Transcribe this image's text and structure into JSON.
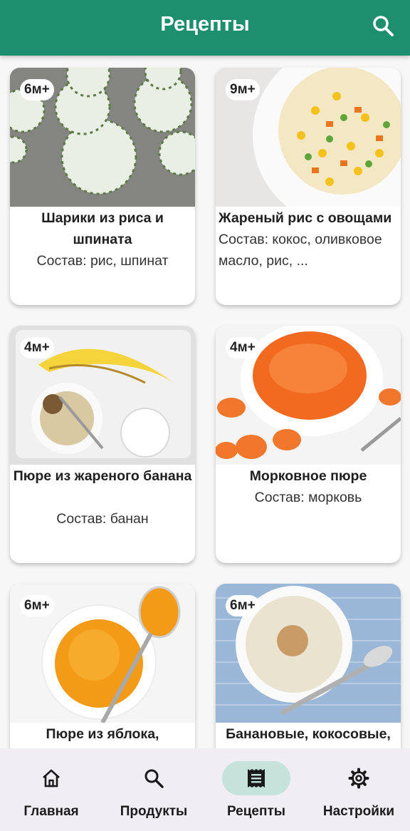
{
  "appbar": {
    "title": "Рецепты",
    "search_icon": "search-icon"
  },
  "recipes": [
    {
      "age": "6м+",
      "title": "Шарики из риса и шпината",
      "description": "Состав: рис, шпинат",
      "image": "rice-spinach-balls"
    },
    {
      "age": "9м+",
      "title": "Жареный рис с овощами",
      "description": "Состав: кокос, оливковое масло, рис, ...",
      "image": "fried-rice-vegetables"
    },
    {
      "age": "4м+",
      "title": "Пюре из жареного банана",
      "description": "Состав: банан",
      "image": "banana-puree"
    },
    {
      "age": "4м+",
      "title": "Морковное пюре",
      "description": "Состав: морковь",
      "image": "carrot-puree"
    },
    {
      "age": "6м+",
      "title": "Пюре из яблока,",
      "description": "",
      "image": "apple-puree"
    },
    {
      "age": "6м+",
      "title": "Банановые, кокосовые,",
      "description": "",
      "image": "banana-coconut-porridge"
    }
  ],
  "bottom_nav": {
    "items": [
      {
        "label": "Главная",
        "icon": "home-icon",
        "active": false
      },
      {
        "label": "Продукты",
        "icon": "search-icon",
        "active": false
      },
      {
        "label": "Рецепты",
        "icon": "receipt-icon",
        "active": true
      },
      {
        "label": "Настройки",
        "icon": "gear-icon",
        "active": false
      }
    ]
  },
  "colors": {
    "primary": "#1e8f6e",
    "nav_active": "#c5e3db",
    "nav_background": "#f1edf4"
  }
}
